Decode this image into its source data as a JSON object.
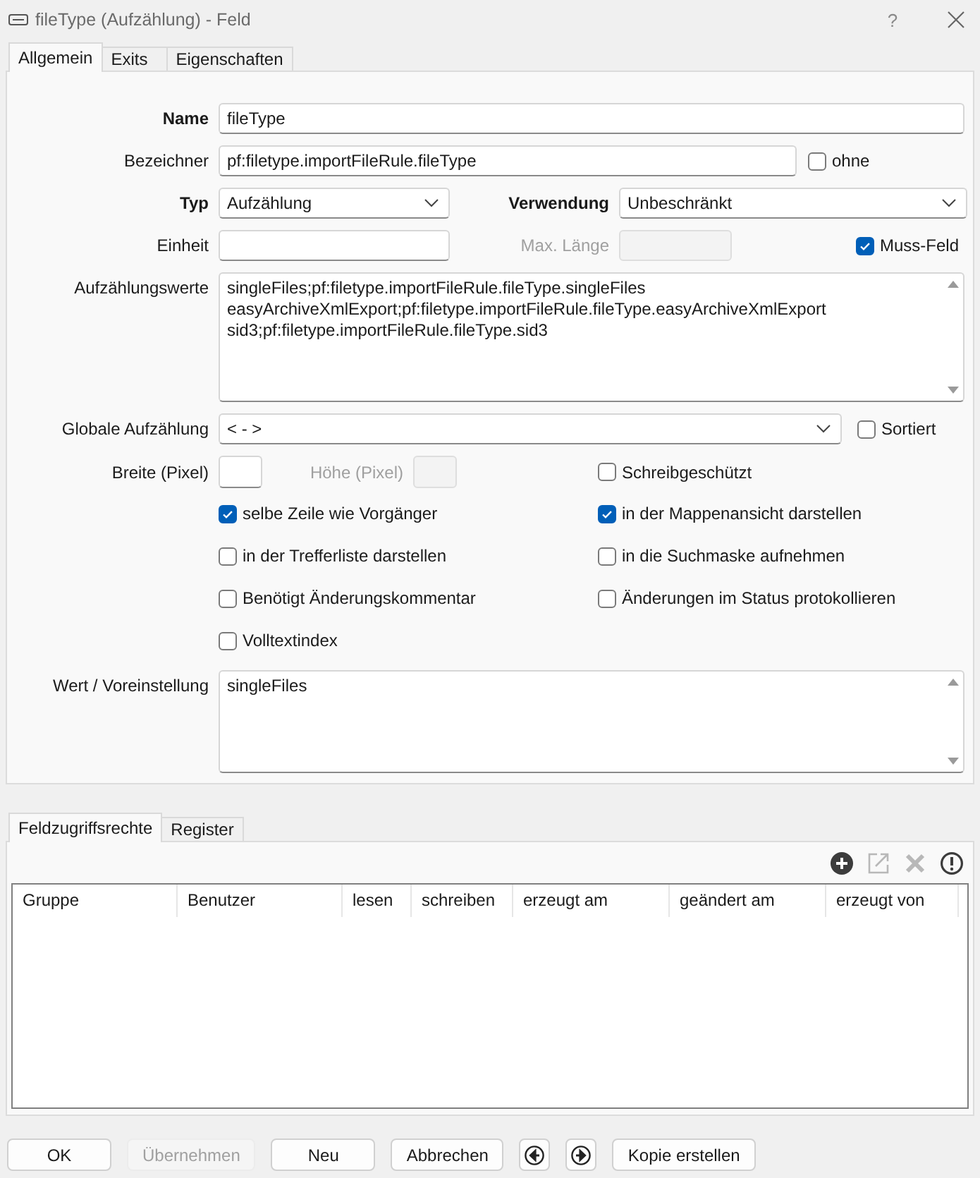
{
  "window": {
    "title": "fileType (Aufzählung) - Feld",
    "help": "?"
  },
  "tabs": [
    {
      "label": "Allgemein",
      "selected": true
    },
    {
      "label": "Exits",
      "selected": false
    },
    {
      "label": "Eigenschaften",
      "selected": false
    }
  ],
  "general": {
    "name": {
      "label": "Name",
      "required": true,
      "value": "fileType"
    },
    "identifier": {
      "label": "Bezeichner",
      "value": "pf:filetype.importFileRule.fileType"
    },
    "without": {
      "label": "ohne",
      "checked": false
    },
    "type": {
      "label": "Typ",
      "required": true,
      "value": "Aufzählung"
    },
    "usage": {
      "label": "Verwendung",
      "required": true,
      "value": "Unbeschränkt"
    },
    "unit": {
      "label": "Einheit"
    },
    "max_length": {
      "label": "Max. Länge",
      "disabled": true
    },
    "mandatory": {
      "label": "Muss-Feld",
      "checked": true
    },
    "enum_values": {
      "label": "Aufzählungswerte",
      "lines": [
        "singleFiles;pf:filetype.importFileRule.fileType.singleFiles",
        "easyArchiveXmlExport;pf:filetype.importFileRule.fileType.easyArchiveXmlExport",
        "sid3;pf:filetype.importFileRule.fileType.sid3"
      ]
    },
    "global_enum": {
      "label": "Globale Aufzählung",
      "value": "< - >"
    },
    "sorted": {
      "label": "Sortiert",
      "checked": false
    },
    "width": {
      "label": "Breite (Pixel)"
    },
    "height": {
      "label": "Höhe (Pixel)",
      "disabled": true
    },
    "read_only": {
      "label": "Schreibgeschützt",
      "checked": false
    },
    "options": [
      {
        "label": "selbe Zeile wie Vorgänger",
        "checked": true
      },
      {
        "label": "in der Mappenansicht darstellen",
        "checked": true
      },
      {
        "label": "in der Trefferliste darstellen",
        "checked": false
      },
      {
        "label": "in die Suchmaske aufnehmen",
        "checked": false
      },
      {
        "label": "Benötigt Änderungskommentar",
        "checked": false
      },
      {
        "label": "Änderungen im Status protokollieren",
        "checked": false
      },
      {
        "label": "Volltextindex",
        "checked": false
      }
    ],
    "default_value": {
      "label": "Wert / Voreinstellung",
      "value": "singleFiles"
    }
  },
  "access": {
    "tabs": [
      {
        "label": "Feldzugriffsrechte",
        "selected": true
      },
      {
        "label": "Register",
        "selected": false
      }
    ],
    "toolbar": [
      {
        "kind": "add",
        "disabled": false
      },
      {
        "kind": "open",
        "disabled": true
      },
      {
        "kind": "delete",
        "disabled": true
      },
      {
        "kind": "info",
        "disabled": false
      }
    ],
    "columns": [
      "Gruppe",
      "Benutzer",
      "lesen",
      "schreiben",
      "erzeugt am",
      "geändert am",
      "erzeugt von"
    ]
  },
  "buttons": [
    {
      "kind": "text",
      "label": "OK",
      "disabled": false
    },
    {
      "kind": "text",
      "label": "Übernehmen",
      "disabled": true
    },
    {
      "kind": "text",
      "label": "Neu",
      "disabled": false
    },
    {
      "kind": "text",
      "label": "Abbrechen",
      "disabled": false
    },
    {
      "kind": "back",
      "disabled": false
    },
    {
      "kind": "forward",
      "disabled": false
    },
    {
      "kind": "text",
      "label": "Kopie erstellen",
      "disabled": false
    }
  ]
}
